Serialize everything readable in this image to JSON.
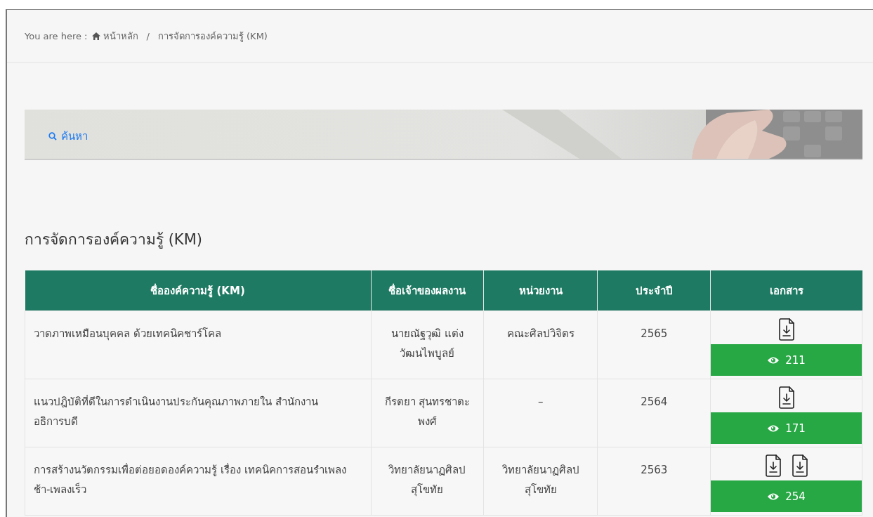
{
  "breadcrumb": {
    "prefix": "You are here :",
    "items": [
      {
        "label": "หน้าหลัก",
        "kind": "home"
      },
      {
        "label": "/",
        "kind": "separator"
      },
      {
        "label": "การจัดการองค์ความรู้ (KM)",
        "kind": "current"
      }
    ]
  },
  "banner": {
    "kind": "picture",
    "search_link": "ค้นหา"
  },
  "heading": "การจัดการองค์ความรู้ (KM)",
  "table": {
    "columns": [
      "ชื่อองค์ความรู้ (KM)",
      "ชื่อเจ้าของผลงาน",
      "หน่วยงาน",
      "ประจำปี",
      "เอกสาร"
    ],
    "rows": [
      {
        "title": "วาดภาพเหมือนบุคคล ด้วยเทคนิคชาร์โคล",
        "owner": "นายณัฐวุฒิ แต่ง วัฒนไพบูลย์",
        "unit": "คณะศิลปวิจิตร",
        "year": "2565",
        "documents": [
          {
            "kind": "file"
          }
        ],
        "views": "211"
      },
      {
        "title": "แนวปฎิบัติที่ดีในการดำเนินงานประกันคุณภาพภายใน สำนักงานอธิการบดี",
        "owner": "กีรตยา สุนทรชาตะ พงศ์",
        "unit": "–",
        "year": "2564",
        "documents": [
          {
            "kind": "file"
          }
        ],
        "views": "171"
      },
      {
        "title": "การสร้างนวัตกรรมเพื่อต่อยอดองค์ความรู้ เรื่อง เทคนิคการสอนรำเพลงช้า-เพลงเร็ว",
        "owner": "วิทยาลัยนาฏศิลป สุโขทัย",
        "unit": "วิทยาลัยนาฏศิลป สุโขทัย",
        "year": "2563",
        "documents": [
          {
            "kind": "file"
          },
          {
            "kind": "file"
          }
        ],
        "views": "254"
      }
    ]
  }
}
